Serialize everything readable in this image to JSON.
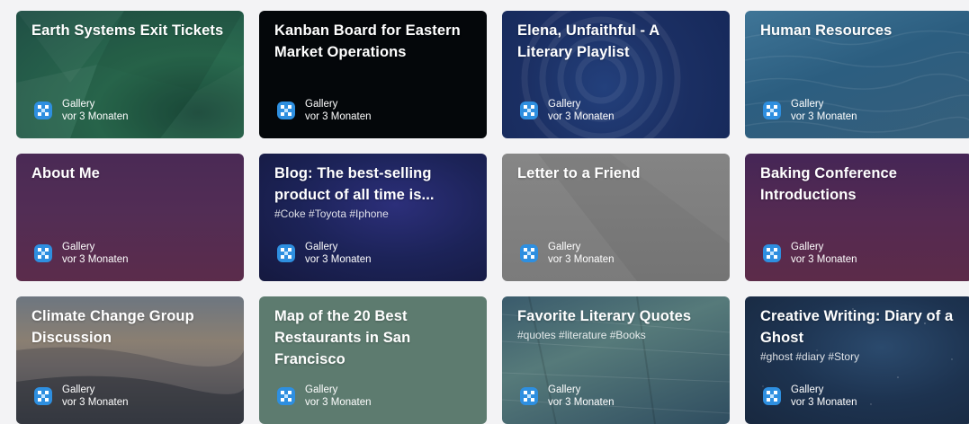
{
  "cards": [
    {
      "title": "Earth Systems Exit Tickets",
      "tags": "",
      "owner": "Gallery",
      "time": "vor 3 Monaten"
    },
    {
      "title": "Kanban Board for Eastern Market Operations",
      "tags": "",
      "owner": "Gallery",
      "time": "vor 3 Monaten"
    },
    {
      "title": "Elena, Unfaithful - A Literary Playlist",
      "tags": "",
      "owner": "Gallery",
      "time": "vor 3 Monaten"
    },
    {
      "title": "Human Resources",
      "tags": "",
      "owner": "Gallery",
      "time": "vor 3 Monaten"
    },
    {
      "title": "About Me",
      "tags": "",
      "owner": "Gallery",
      "time": "vor 3 Monaten"
    },
    {
      "title": "Blog: The best-selling product of all time is...",
      "tags": "#Coke #Toyota #Iphone",
      "owner": "Gallery",
      "time": "vor 3 Monaten"
    },
    {
      "title": "Letter to a Friend",
      "tags": "",
      "owner": "Gallery",
      "time": "vor 3 Monaten"
    },
    {
      "title": "Baking Conference Introductions",
      "tags": "",
      "owner": "Gallery",
      "time": "vor 3 Monaten"
    },
    {
      "title": "Climate Change Group Discussion",
      "tags": "",
      "owner": "Gallery",
      "time": "vor 3 Monaten"
    },
    {
      "title": "Map of the 20 Best Restaurants in San Francisco",
      "tags": "",
      "owner": "Gallery",
      "time": "vor 3 Monaten"
    },
    {
      "title": "Favorite Literary Quotes",
      "tags": "#quotes #literature #Books",
      "owner": "Gallery",
      "time": "vor 3 Monaten"
    },
    {
      "title": "Creative Writing: Diary of a Ghost",
      "tags": "#ghost #diary #Story",
      "owner": "Gallery",
      "time": "vor 3 Monaten"
    }
  ],
  "avatar_icon": "gallery-owner-icon"
}
